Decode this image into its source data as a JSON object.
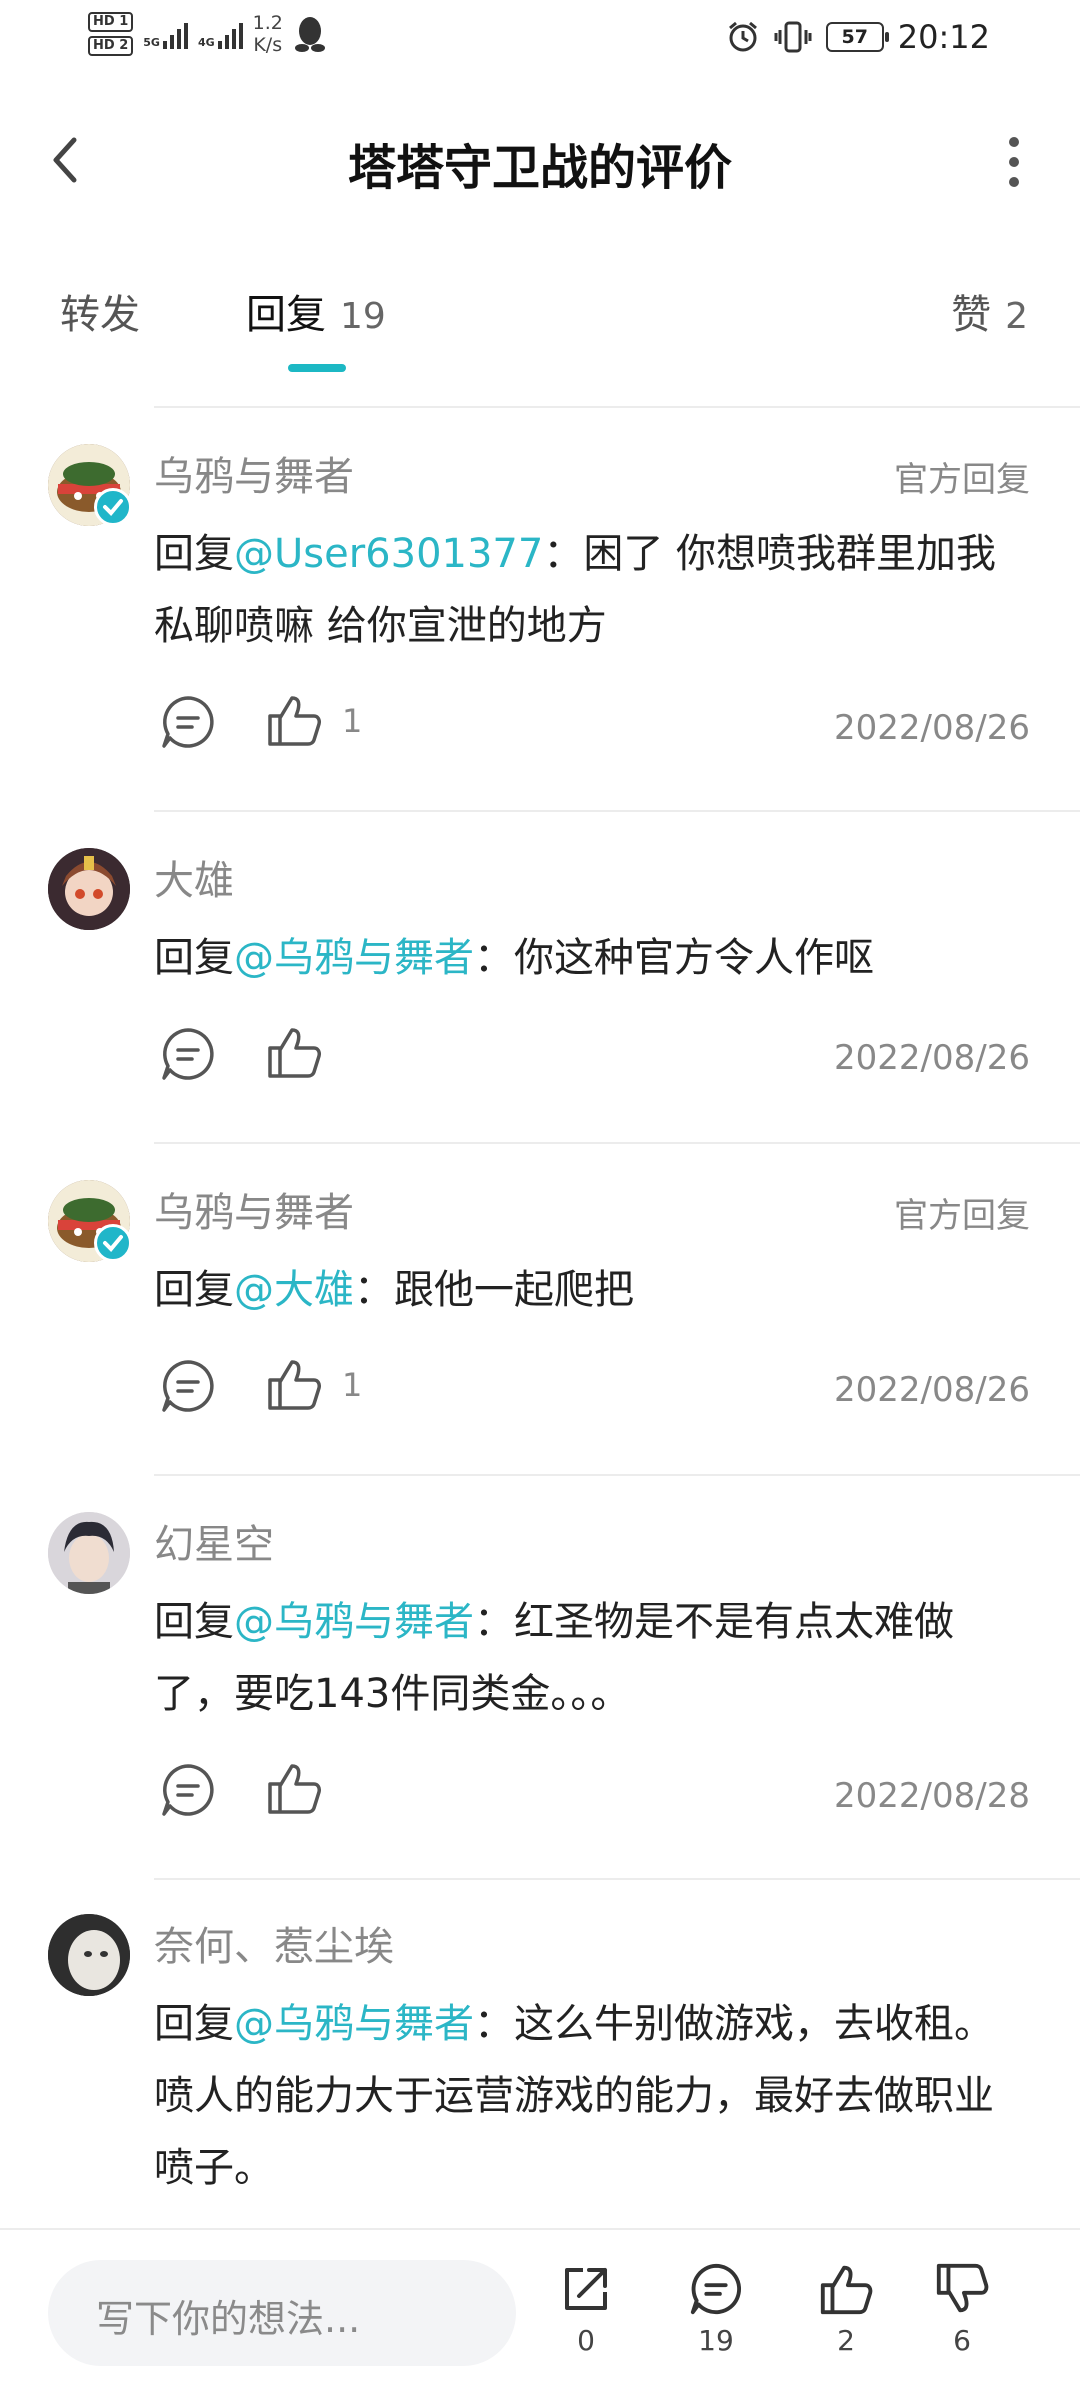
{
  "status_bar": {
    "hd1": "HD 1",
    "hd2": "HD 2",
    "net1": "5G",
    "net2": "4G",
    "speed_value": "1.2",
    "speed_unit": "K/s",
    "battery": "57",
    "time": "20:12"
  },
  "header": {
    "title": "塔塔守卫战的评价"
  },
  "tabs": {
    "forward": "转发",
    "reply": "回复",
    "reply_count": "19",
    "like": "赞",
    "like_count": "2"
  },
  "comments": [
    {
      "user": "乌鸦与舞者",
      "official": "官方回复",
      "reply_prefix": "回复",
      "mention": "@User6301377",
      "text": "：困了 你想喷我群里加我私聊喷嘛 给你宣泄的地方",
      "likes": "1",
      "date": "2022/08/26"
    },
    {
      "user": "大雄",
      "reply_prefix": "回复",
      "mention": "@乌鸦与舞者",
      "text": "：你这种官方令人作呕",
      "date": "2022/08/26"
    },
    {
      "user": "乌鸦与舞者",
      "official": "官方回复",
      "reply_prefix": "回复",
      "mention": "@大雄",
      "text": "：跟他一起爬把",
      "likes": "1",
      "date": "2022/08/26"
    },
    {
      "user": "幻星空",
      "reply_prefix": "回复",
      "mention": "@乌鸦与舞者",
      "text": "：红圣物是不是有点太难做了，要吃143件同类金。。。",
      "date": "2022/08/28"
    },
    {
      "user": "奈何、惹尘埃",
      "reply_prefix": "回复",
      "mention": "@乌鸦与舞者",
      "text": "：这么牛别做游戏，去收租。喷人的能力大于运营游戏的能力，最好去做职业喷子。"
    }
  ],
  "bottom_bar": {
    "placeholder": "写下你的想法...",
    "share_count": "0",
    "comment_count": "19",
    "like_count": "2",
    "dislike_count": "6"
  },
  "colors": {
    "accent": "#1cb8c4",
    "mention": "#2bb6c6",
    "verified": "#20b6c9"
  }
}
